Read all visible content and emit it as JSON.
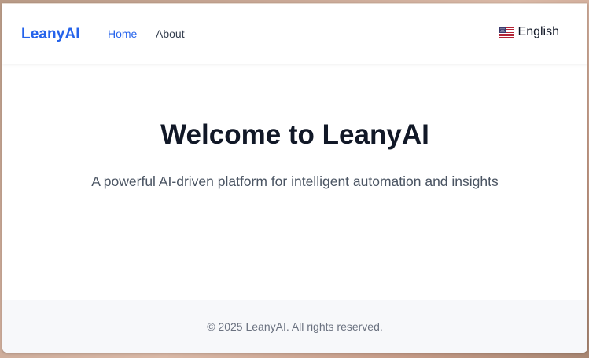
{
  "navbar": {
    "brand": "LeanyAI",
    "links": [
      {
        "label": "Home",
        "active": true
      },
      {
        "label": "About",
        "active": false
      }
    ],
    "language": {
      "label": "English",
      "icon": "us-flag-icon"
    }
  },
  "hero": {
    "title": "Welcome to LeanyAI",
    "subtitle": "A powerful AI-driven platform for intelligent automation and insights"
  },
  "footer": {
    "copyright": "© 2025 LeanyAI. All rights reserved."
  },
  "colors": {
    "brand": "#2563eb",
    "heading": "#111827",
    "body_text": "#4b5563",
    "footer_bg": "#f7f8fa"
  }
}
